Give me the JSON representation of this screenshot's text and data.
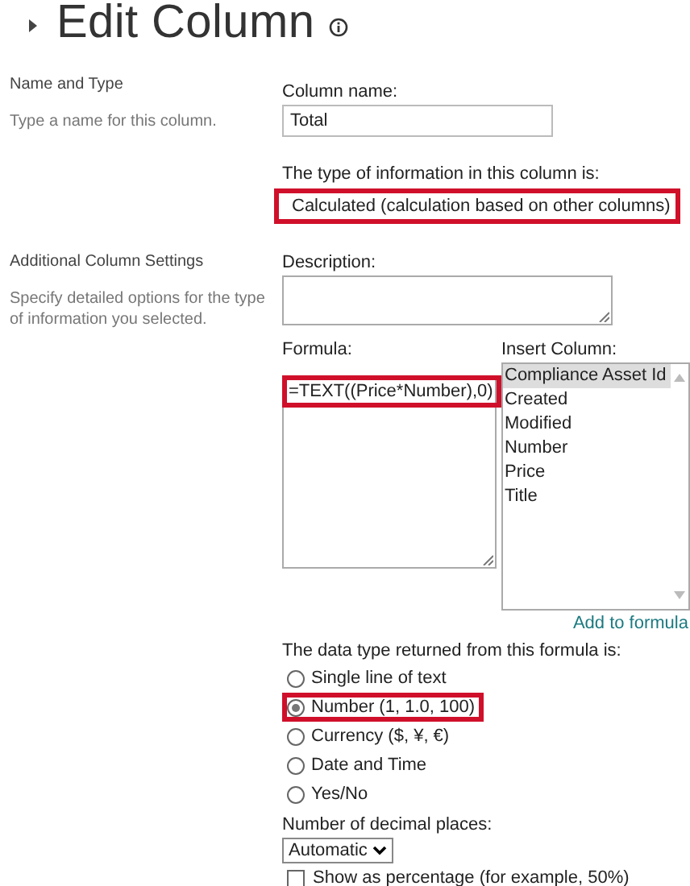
{
  "title": "Edit Column",
  "sections": [
    {
      "heading": "Name and Type",
      "description": "Type a name for this column."
    },
    {
      "heading": "Additional Column Settings",
      "description": "Specify detailed options for the type of information you selected."
    }
  ],
  "column_name": {
    "label": "Column name:",
    "value": "Total"
  },
  "type_info": {
    "label": "The type of information in this column is:",
    "value": "Calculated (calculation based on other columns)",
    "highlighted": true
  },
  "description": {
    "label": "Description:"
  },
  "formula": {
    "label": "Formula:",
    "value": "=TEXT((Price*Number),0)",
    "highlighted": true
  },
  "insert_column": {
    "label": "Insert Column:",
    "items": [
      {
        "label": "Compliance Asset Id",
        "selected": true
      },
      {
        "label": "Created",
        "selected": false
      },
      {
        "label": "Modified",
        "selected": false
      },
      {
        "label": "Number",
        "selected": false
      },
      {
        "label": "Price",
        "selected": false
      },
      {
        "label": "Title",
        "selected": false
      }
    ],
    "link": "Add to formula"
  },
  "data_type": {
    "label": "The data type returned from this formula is:",
    "options": [
      {
        "label": "Single line of text",
        "selected": false,
        "highlighted": false
      },
      {
        "label": "Number (1, 1.0, 100)",
        "selected": true,
        "highlighted": true
      },
      {
        "label": "Currency ($, ¥, €)",
        "selected": false,
        "highlighted": false
      },
      {
        "label": "Date and Time",
        "selected": false,
        "highlighted": false
      },
      {
        "label": "Yes/No",
        "selected": false,
        "highlighted": false
      }
    ]
  },
  "decimal_places": {
    "label": "Number of decimal places:",
    "value": "Automatic"
  },
  "percentage": {
    "label": "Show as percentage (for example, 50%)",
    "checked": false
  }
}
